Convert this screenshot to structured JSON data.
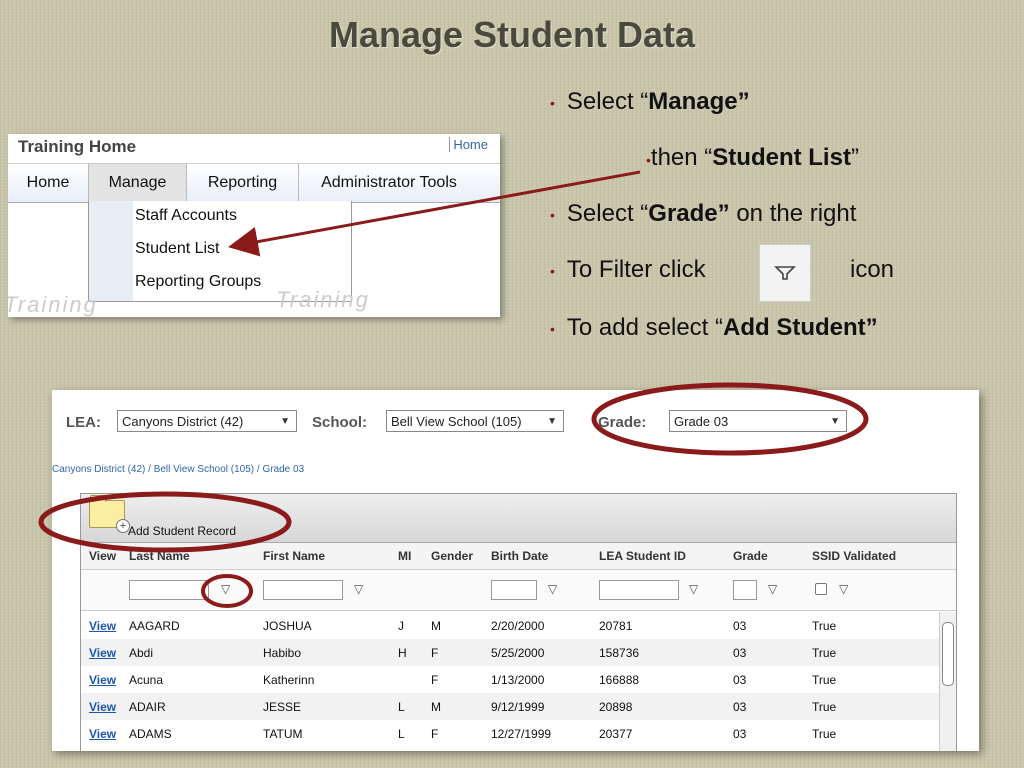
{
  "title": "Manage Student Data",
  "bullets": [
    {
      "pre": "Select “",
      "bold": "Manage”",
      "post": ""
    },
    {
      "pre": "then “",
      "bold": "Student  List",
      "post": "”"
    },
    {
      "pre": "Select “",
      "bold": "Grade”",
      "post": "  on the right"
    },
    {
      "pre": "To Filter click",
      "bold": "",
      "post": "icon"
    },
    {
      "pre": "To add select “",
      "bold": "Add Student”",
      "post": ""
    }
  ],
  "menu_screenshot": {
    "header": "Training Home",
    "home_link": "Home",
    "nav": [
      "Home",
      "Manage",
      "Reporting",
      "Administrator Tools"
    ],
    "dropdown": [
      "Staff Accounts",
      "Student List",
      "Reporting Groups"
    ],
    "watermark": "Training"
  },
  "grid_screenshot": {
    "lea_label": "LEA:",
    "lea_value": "Canyons District (42)",
    "school_label": "School:",
    "school_value": "Bell View School (105)",
    "grade_label": "Grade:",
    "grade_value": "Grade 03",
    "breadcrumb": "Canyons District (42) / Bell View School (105) / Grade 03",
    "add_label": "Add Student Record",
    "columns": [
      "View",
      "Last Name",
      "First Name",
      "MI",
      "Gender",
      "Birth Date",
      "LEA Student ID",
      "Grade",
      "SSID Validated"
    ],
    "rows": [
      [
        "View",
        "AAGARD",
        "JOSHUA",
        "J",
        "M",
        "2/20/2000",
        "20781",
        "03",
        "True"
      ],
      [
        "View",
        "Abdi",
        "Habibo",
        "H",
        "F",
        "5/25/2000",
        "158736",
        "03",
        "True"
      ],
      [
        "View",
        "Acuna",
        "Katherinn",
        "",
        "F",
        "1/13/2000",
        "166888",
        "03",
        "True"
      ],
      [
        "View",
        "ADAIR",
        "JESSE",
        "L",
        "M",
        "9/12/1999",
        "20898",
        "03",
        "True"
      ],
      [
        "View",
        "ADAMS",
        "TATUM",
        "L",
        "F",
        "12/27/1999",
        "20377",
        "03",
        "True"
      ]
    ]
  },
  "colors": {
    "annotation": "#8b1a1a",
    "link": "#1c56b0"
  }
}
